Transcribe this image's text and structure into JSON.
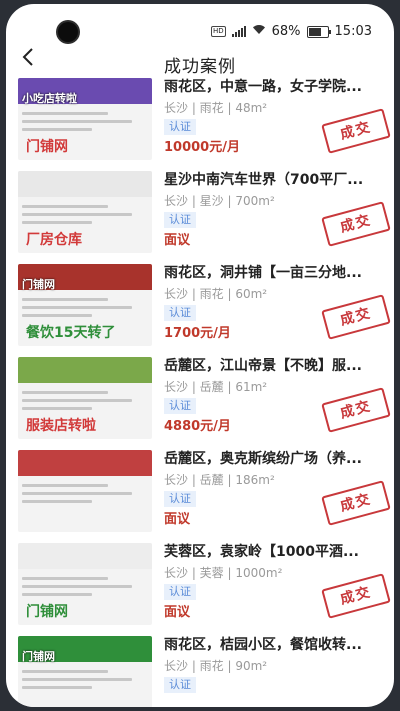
{
  "status_bar": {
    "battery": "68%",
    "time": "15:03",
    "network": "HD"
  },
  "header": {
    "title": "成功案例",
    "back_icon": "chevron-left-icon"
  },
  "cases": [
    {
      "title": "雨花区，中意一路，女子学院...",
      "location": "长沙 | 雨花 | 48m²",
      "tag": "认证",
      "price": "10000元/月",
      "stamp": "成交",
      "thumb": {
        "banner_color": "#6a4bb0",
        "caption": "小吃店转啦",
        "big_text": "门铺网",
        "big_color": "#d23a3a"
      }
    },
    {
      "title": "星沙中南汽车世界（700平厂...",
      "location": "长沙 | 星沙 | 700m²",
      "tag": "认证",
      "price": "面议",
      "stamp": "成交",
      "thumb": {
        "banner_color": "#e8e8e8",
        "caption": "",
        "big_text": "厂房仓库",
        "big_color": "#d23a3a"
      }
    },
    {
      "title": "雨花区，洞井铺【一亩三分地...",
      "location": "长沙 | 雨花 | 60m²",
      "tag": "认证",
      "price": "1700元/月",
      "stamp": "成交",
      "thumb": {
        "banner_color": "#a8332c",
        "caption": "门铺网",
        "big_text": "餐饮15天转了",
        "big_color": "#2f8f3a"
      }
    },
    {
      "title": "岳麓区，江山帝景【不晚】服...",
      "location": "长沙 | 岳麓 | 61m²",
      "tag": "认证",
      "price": "4880元/月",
      "stamp": "成交",
      "thumb": {
        "banner_color": "#7ba84a",
        "caption": "",
        "big_text": "服装店转啦",
        "big_color": "#d23a3a"
      }
    },
    {
      "title": "岳麓区，奥克斯缤纷广场（养...",
      "location": "长沙 | 岳麓 | 186m²",
      "tag": "认证",
      "price": "面议",
      "stamp": "成交",
      "thumb": {
        "banner_color": "#c04040",
        "caption": "",
        "big_text": "",
        "big_color": "#d23a3a"
      }
    },
    {
      "title": "芙蓉区，袁家岭【1000平酒...",
      "location": "长沙 | 芙蓉 | 1000m²",
      "tag": "认证",
      "price": "面议",
      "stamp": "成交",
      "thumb": {
        "banner_color": "#ededed",
        "caption": "",
        "big_text": "门铺网",
        "big_color": "#2f8f3a"
      }
    },
    {
      "title": "雨花区，桔园小区，餐馆收转...",
      "location": "长沙 | 雨花 | 90m²",
      "tag": "认证",
      "price": "",
      "stamp": "",
      "thumb": {
        "banner_color": "#2f8f3a",
        "caption": "门铺网",
        "big_text": "",
        "big_color": "#2f8f3a"
      }
    }
  ]
}
